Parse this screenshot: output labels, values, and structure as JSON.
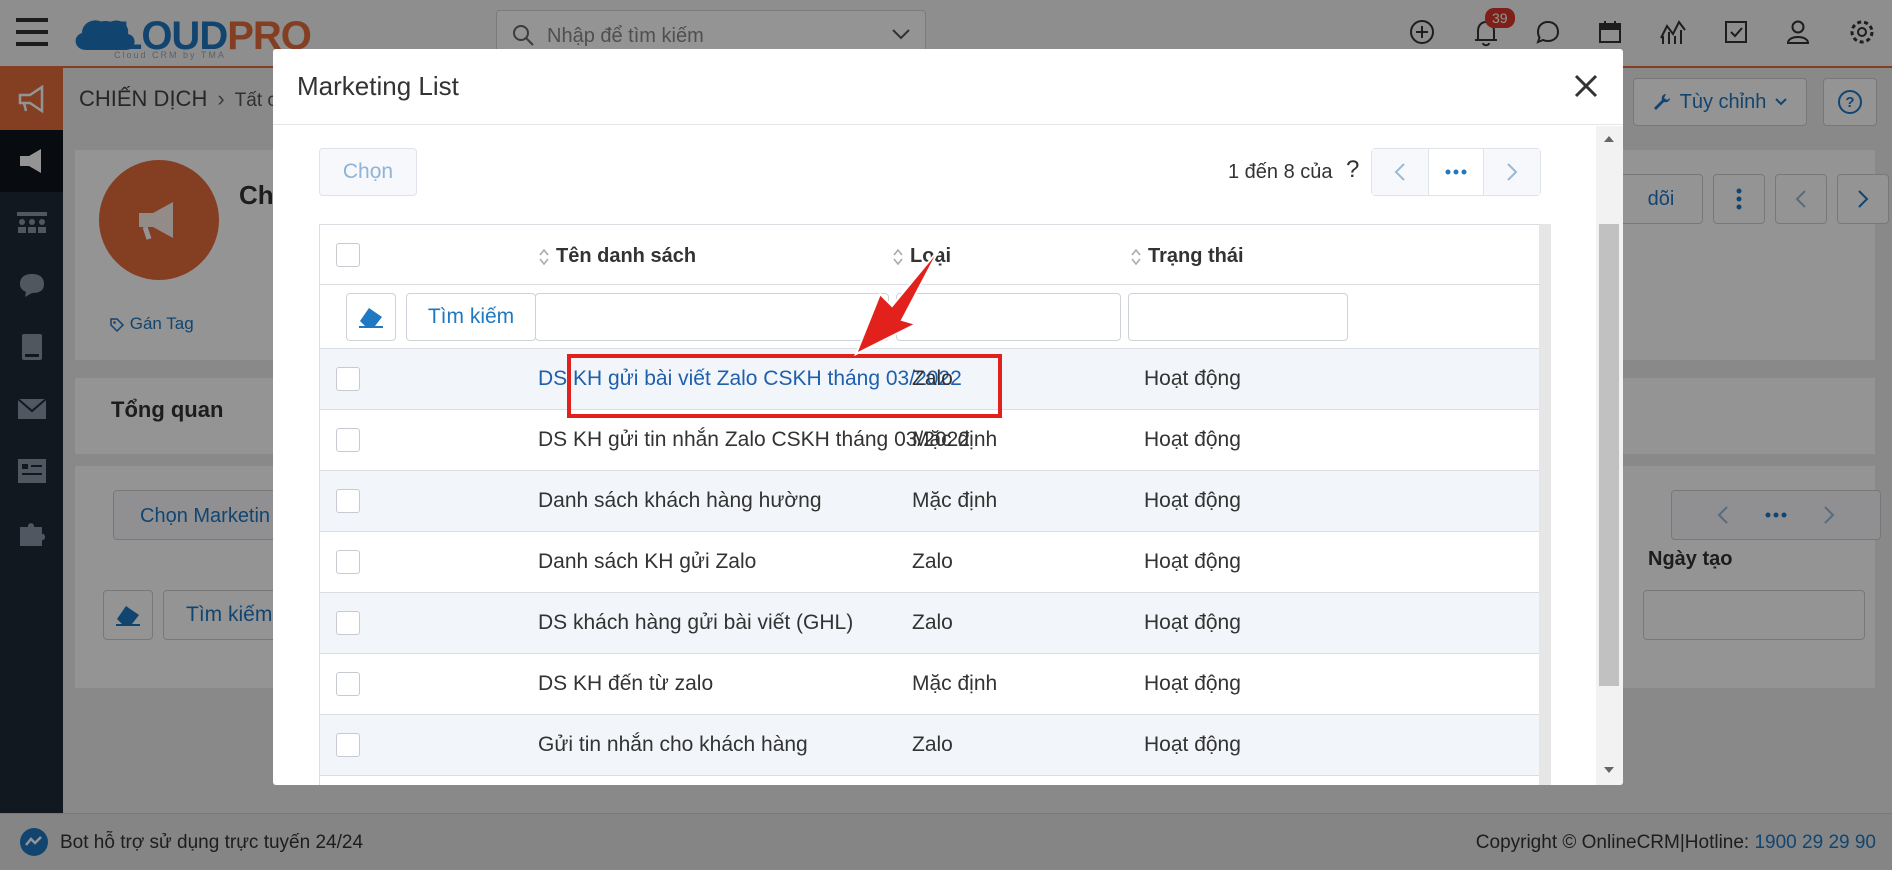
{
  "app": {
    "logo_text_a": "CLOUD",
    "logo_text_b": "PRO",
    "logo_sub": "Cloud CRM by TMA",
    "search_placeholder": "Nhập để tìm kiếm",
    "notification_count": "39"
  },
  "background": {
    "breadcrumb_main": "CHIẾN DỊCH",
    "breadcrumb_sub": "Tất c",
    "customize_label": "Tùy chỉnh",
    "record_title": "Ch",
    "tag_label": "Gán Tag",
    "follow_label": "dõi",
    "tab_label": "Tổng quan",
    "choose_marketing_label": "Chọn Marketin",
    "column_created": "Ngày tạo",
    "search_label": "Tìm kiếm"
  },
  "footer": {
    "support_text": "Bot hỗ trợ sử dụng trực tuyến 24/24",
    "copyright": "Copyright © OnlineCRM|Hotline: ",
    "hotline": "1900 29 29 90"
  },
  "modal": {
    "title": "Marketing List",
    "select_label": "Chọn",
    "pagination_text": "1 đến 8 của",
    "pagination_unknown": "?",
    "columns": {
      "name": "Tên danh sách",
      "type": "Loại",
      "status": "Trạng thái"
    },
    "filter_search_label": "Tìm kiếm",
    "rows": [
      {
        "name": "DS KH gửi bài viết Zalo CSKH tháng 03/2022",
        "type": "Zalo",
        "status": "Hoạt động"
      },
      {
        "name": "DS KH gửi tin nhắn Zalo CSKH tháng 03/2022",
        "type": "Mặc định",
        "status": "Hoạt động"
      },
      {
        "name": "Danh sách khách hàng hường",
        "type": "Mặc định",
        "status": "Hoạt động"
      },
      {
        "name": "Danh sách KH gửi Zalo",
        "type": "Zalo",
        "status": "Hoạt động"
      },
      {
        "name": "DS khách hàng gửi bài viết (GHL)",
        "type": "Zalo",
        "status": "Hoạt động"
      },
      {
        "name": "DS KH đến từ zalo",
        "type": "Mặc định",
        "status": "Hoạt động"
      },
      {
        "name": "Gửi tin nhắn cho khách hàng",
        "type": "Zalo",
        "status": "Hoạt động"
      }
    ]
  },
  "colors": {
    "brand_blue": "#1e78c2",
    "brand_orange": "#e36b3a",
    "highlight_red": "#e3211c",
    "sidebar": "#1f2a38"
  }
}
